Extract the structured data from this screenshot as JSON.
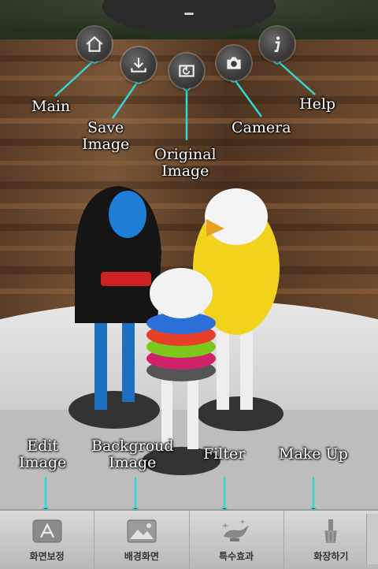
{
  "top_buttons": [
    {
      "label": "Main",
      "icon": "home-icon"
    },
    {
      "label": "Save Image",
      "icon": "download-icon"
    },
    {
      "label": "Original Image",
      "icon": "restore-icon"
    },
    {
      "label": "Camera",
      "icon": "camera-icon"
    },
    {
      "label": "Help",
      "icon": "info-icon"
    }
  ],
  "callouts": {
    "main": "Main",
    "save_line1": "Save",
    "save_line2": "Image",
    "original_line1": "Original",
    "original_line2": "Image",
    "camera": "Camera",
    "help": "Help",
    "edit_line1": "Edit",
    "edit_line2": "Image",
    "background_line1": "Backgroud",
    "background_line2": "Image",
    "filter": "Filter",
    "makeup": "Make Up"
  },
  "toolbar": {
    "items": [
      {
        "label": "화면보정",
        "icon": "app-store-icon"
      },
      {
        "label": "배경화면",
        "icon": "picture-icon"
      },
      {
        "label": "특수효과",
        "icon": "magic-lamp-icon"
      },
      {
        "label": "화장하기",
        "icon": "makeup-brush-icon"
      }
    ]
  },
  "colors": {
    "accent": "#33d6d6",
    "toolbar_bg": "#c8c8c8"
  }
}
